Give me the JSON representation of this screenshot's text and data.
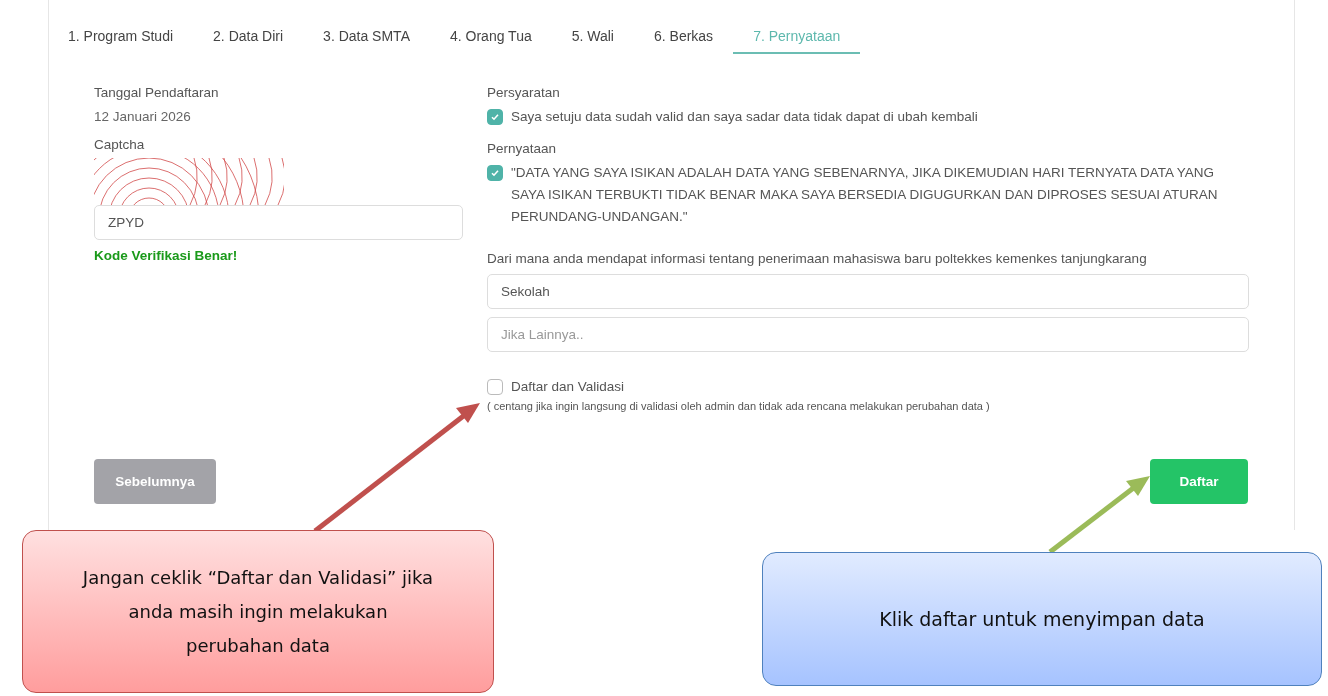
{
  "tabs": [
    {
      "label": "1. Program Studi",
      "selected": false
    },
    {
      "label": "2. Data Diri",
      "selected": false
    },
    {
      "label": "3. Data SMTA",
      "selected": false
    },
    {
      "label": "4. Orang Tua",
      "selected": false
    },
    {
      "label": "5. Wali",
      "selected": false
    },
    {
      "label": "6. Berkas",
      "selected": false
    },
    {
      "label": "7. Pernyataan",
      "selected": true
    }
  ],
  "left": {
    "date_label": "Tanggal Pendaftaran",
    "date_value": "12 Januari 2026",
    "captcha_label": "Captcha",
    "captcha_value": "ZPYD",
    "captcha_message": "Kode Verifikasi Benar!"
  },
  "right": {
    "requirements_label": "Persyaratan",
    "requirements": {
      "text": "Saya setuju data sudah valid dan saya sadar data tidak dapat di ubah kembali",
      "checked": true
    },
    "statement_label": "Pernyataan",
    "statement": {
      "text": "\"DATA YANG SAYA ISIKAN ADALAH DATA YANG SEBENARNYA, JIKA DIKEMUDIAN HARI TERNYATA DATA YANG SAYA ISIKAN TERBUKTI TIDAK BENAR MAKA SAYA BERSEDIA DIGUGURKAN DAN DIPROSES SESUAI ATURAN PERUNDANG-UNDANGAN.\"",
      "checked": true
    },
    "source_question": "Dari mana anda mendapat informasi tentang penerimaan mahasiswa baru poltekkes kemenkes tanjungkarang",
    "source_value": "Sekolah",
    "other_placeholder": "Jika Lainnya..",
    "validate": {
      "text": "Daftar dan Validasi",
      "checked": false
    },
    "validate_hint": "( centang jika ingin langsung di validasi oleh admin dan tidak ada rencana melakukan perubahan data )"
  },
  "buttons": {
    "previous": "Sebelumnya",
    "submit": "Daftar"
  },
  "callouts": [
    {
      "kind": "warning",
      "text": "Jangan ceklik “Daftar dan Validasi” jika anda masih ingin melakukan perubahan data"
    },
    {
      "kind": "info",
      "text": "Klik daftar untuk menyimpan data"
    }
  ]
}
